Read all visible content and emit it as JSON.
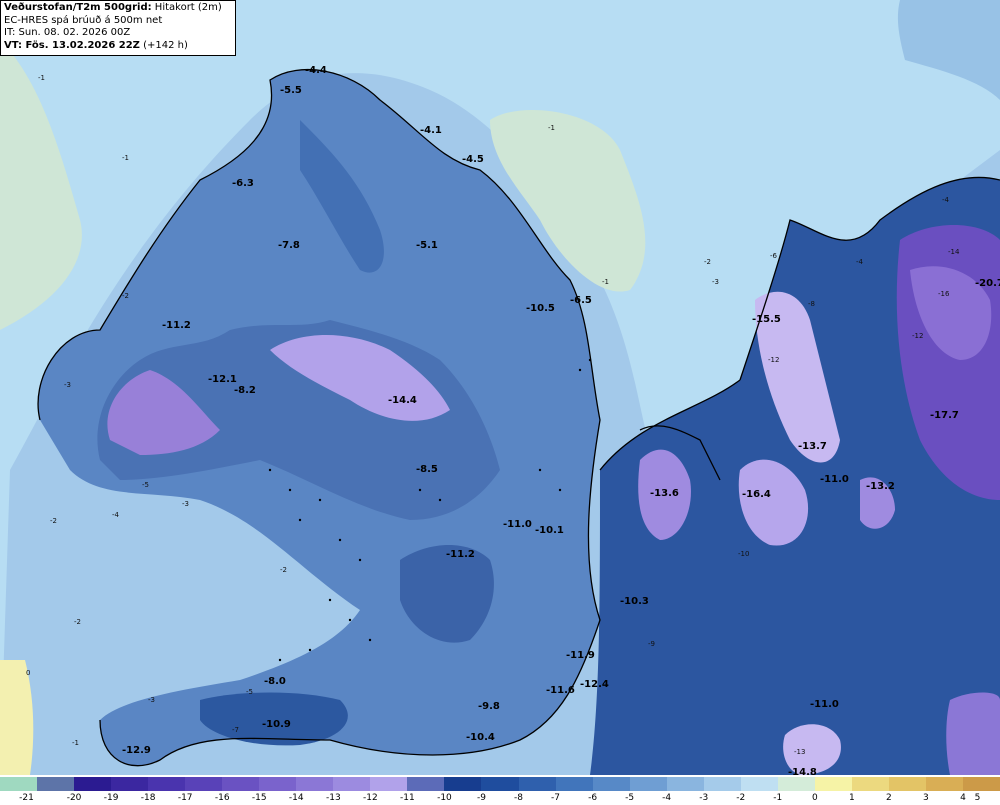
{
  "header": {
    "title": "Veðurstofan/T2m 500grid:",
    "subtitle": "Hitakort (2m)",
    "model": "EC-HRES spá brúuð á 500m net",
    "init_time": "IT: Sun. 08. 02. 2026 00Z",
    "valid_prefix": "VT: Fös. 13.02.2026 22Z",
    "lead": "(+142 h)"
  },
  "legend": {
    "ticks": [
      "-21",
      "-20",
      "-19",
      "-18",
      "-17",
      "-16",
      "-15",
      "-14",
      "-13",
      "-12",
      "-11",
      "-10",
      "-9",
      "-8",
      "-7",
      "-6",
      "-5",
      "-4",
      "-3",
      "-2",
      "-1",
      "0",
      "1",
      "2",
      "3",
      "4",
      "5"
    ],
    "colors": [
      "#9fd9c0",
      "#5d74a8",
      "#2b1b91",
      "#3b27a0",
      "#4a34ae",
      "#5942b8",
      "#6a52c2",
      "#7a63cc",
      "#8b77d6",
      "#9c8be0",
      "#b1a2ea",
      "#5c6bb8",
      "#173d8f",
      "#1f4d9e",
      "#2f60ad",
      "#4175bb",
      "#5789c7",
      "#6f9ed3",
      "#8ab5df",
      "#a5cbea",
      "#bfdff2",
      "#d4ecd9",
      "#f6f3a6",
      "#ecd97f",
      "#e3c466",
      "#d9ae55",
      "#cc9a48"
    ]
  },
  "map_labels": {
    "major": [
      {
        "text": "-6.3"
      },
      {
        "text": "-7.8"
      },
      {
        "text": "-11.2"
      },
      {
        "text": "-12.1"
      },
      {
        "text": "-8.2"
      },
      {
        "text": "-14.4"
      },
      {
        "text": "-5.1"
      },
      {
        "text": "-10.5"
      },
      {
        "text": "-6.5"
      },
      {
        "text": "-8.5"
      },
      {
        "text": "-11.0"
      },
      {
        "text": "-10.1"
      },
      {
        "text": "-11.2"
      },
      {
        "text": "-10.3"
      },
      {
        "text": "-11.9"
      },
      {
        "text": "-11.6"
      },
      {
        "text": "-12.4"
      },
      {
        "text": "-8.0"
      },
      {
        "text": "-10.9"
      },
      {
        "text": "-9.8"
      },
      {
        "text": "-10.4"
      },
      {
        "text": "-12.9"
      },
      {
        "text": "-13.6"
      },
      {
        "text": "-15.5"
      },
      {
        "text": "-13.7"
      },
      {
        "text": "-16.4"
      },
      {
        "text": "-11.0"
      },
      {
        "text": "-13.2"
      },
      {
        "text": "-20.7"
      },
      {
        "text": "-17.7"
      },
      {
        "text": "-11.0"
      },
      {
        "text": "-14.8"
      },
      {
        "text": "-5.5"
      },
      {
        "text": "-4.4"
      },
      {
        "text": "-4.1"
      },
      {
        "text": "-4.5"
      }
    ],
    "minor": [
      {
        "text": "-1"
      },
      {
        "text": "-1"
      },
      {
        "text": "-1"
      },
      {
        "text": "-2"
      },
      {
        "text": "-2"
      },
      {
        "text": "-3"
      },
      {
        "text": "-4"
      },
      {
        "text": "-5"
      },
      {
        "text": "-2"
      },
      {
        "text": "-3"
      },
      {
        "text": "-4"
      },
      {
        "text": "-1"
      },
      {
        "text": "-2"
      },
      {
        "text": "-3"
      },
      {
        "text": "-6"
      },
      {
        "text": "-8"
      },
      {
        "text": "-12"
      },
      {
        "text": "-14"
      },
      {
        "text": "-16"
      },
      {
        "text": "-10"
      },
      {
        "text": "-12"
      },
      {
        "text": "-13"
      },
      {
        "text": "-2"
      },
      {
        "text": "0"
      },
      {
        "text": "-1"
      },
      {
        "text": "-3"
      },
      {
        "text": "-5"
      },
      {
        "text": "-7"
      },
      {
        "text": "-9"
      },
      {
        "text": "-4"
      }
    ]
  }
}
